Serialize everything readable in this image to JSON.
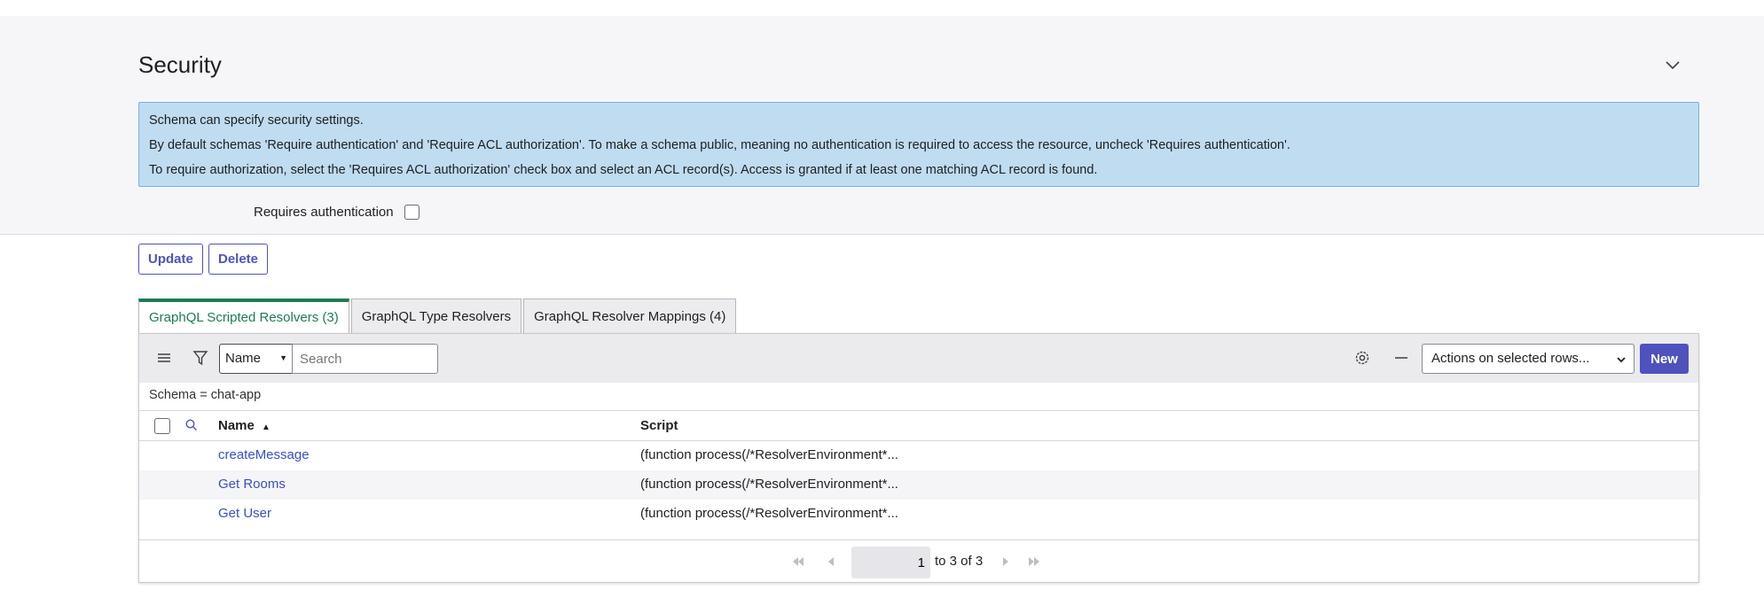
{
  "section": {
    "title": "Security",
    "info_lines": [
      "Schema can specify security settings.",
      "By default schemas 'Require authentication' and 'Require ACL authorization'. To make a schema public, meaning no authentication is required to access the resource, uncheck 'Requires authentication'.",
      "To require authorization, select the 'Requires ACL authorization' check box and select an ACL record(s). Access is granted if at least one matching ACL record is found."
    ],
    "requires_auth_label": "Requires authentication",
    "requires_auth_checked": false
  },
  "buttons": {
    "update": "Update",
    "delete": "Delete"
  },
  "tabs": [
    {
      "label": "GraphQL Scripted Resolvers (3)",
      "active": true
    },
    {
      "label": "GraphQL Type Resolvers",
      "active": false
    },
    {
      "label": "GraphQL Resolver Mappings (4)",
      "active": false
    }
  ],
  "list": {
    "search_field": "Name",
    "search_placeholder": "Search",
    "actions_label": "Actions on selected rows...",
    "new_label": "New",
    "breadcrumb": "Schema = chat-app",
    "columns": {
      "name": "Name",
      "script": "Script"
    },
    "rows": [
      {
        "name": "createMessage",
        "script": "(function process(/*ResolverEnvironment*..."
      },
      {
        "name": "Get Rooms",
        "script": "(function process(/*ResolverEnvironment*..."
      },
      {
        "name": "Get User",
        "script": "(function process(/*ResolverEnvironment*..."
      }
    ],
    "pagination": {
      "page": "1",
      "text": "to 3 of 3"
    }
  },
  "colors": {
    "accent": "#4f52bd",
    "active_tab": "#1d7c52",
    "info_bg": "#bfdcf1",
    "link": "#3a4fc4"
  },
  "icons": [
    "chevron-down-icon",
    "hamburger-menu-icon",
    "filter-icon",
    "search-icon",
    "sort-ascending-icon",
    "gear-icon",
    "minus-icon",
    "first-page-icon",
    "previous-page-icon",
    "next-page-icon",
    "last-page-icon"
  ]
}
